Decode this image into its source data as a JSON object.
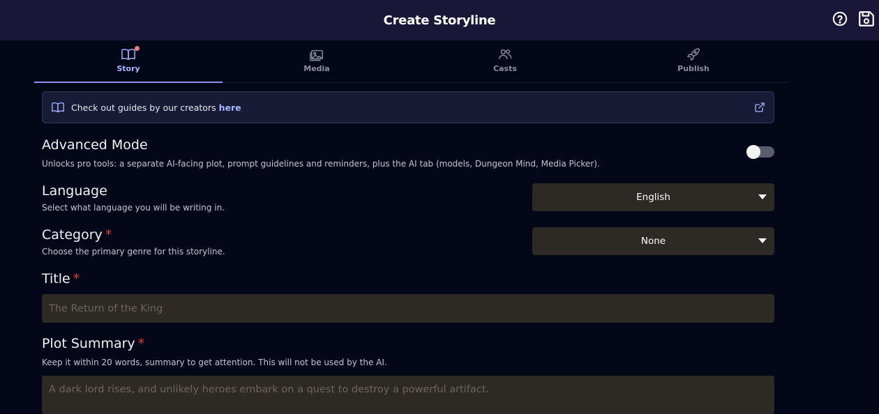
{
  "header": {
    "title": "Create Storyline",
    "help_icon": "help-circle-icon",
    "save_icon": "save-floppy-icon"
  },
  "tabs": [
    {
      "label": "Story",
      "icon": "book-open-icon",
      "active": true,
      "notification_dot": true
    },
    {
      "label": "Media",
      "icon": "image-icon",
      "active": false
    },
    {
      "label": "Casts",
      "icon": "users-icon",
      "active": false
    },
    {
      "label": "Publish",
      "icon": "rocket-icon",
      "active": false
    }
  ],
  "guide_banner": {
    "text": "Check out guides by our creators",
    "link": "here",
    "icon": "book-open-icon",
    "external_icon": "external-link-icon"
  },
  "advanced_mode": {
    "title": "Advanced Mode",
    "description": "Unlocks pro tools: a separate AI-facing plot, prompt guidelines and reminders, plus the AI tab (models, Dungeon Mind, Media Picker).",
    "enabled": false
  },
  "language": {
    "title": "Language",
    "description": "Select what language you will be writing in.",
    "value": "English"
  },
  "category": {
    "title": "Category",
    "required_mark": "*",
    "description": "Choose the primary genre for this storyline.",
    "value": "None"
  },
  "title_field": {
    "title": "Title",
    "required_mark": "*",
    "placeholder": "The Return of the King"
  },
  "plot_summary": {
    "title": "Plot Summary",
    "required_mark": "*",
    "description": "Keep it within 20 words, summary to get attention. This will not be used by the AI.",
    "placeholder": "A dark lord rises, and unlikely heroes embark on a quest to destroy a powerful artifact."
  },
  "colors": {
    "background": "#030718",
    "header": "#1a1638",
    "accent": "#a9b4ff",
    "field": "#2d2925",
    "required": "#e03a3a"
  }
}
